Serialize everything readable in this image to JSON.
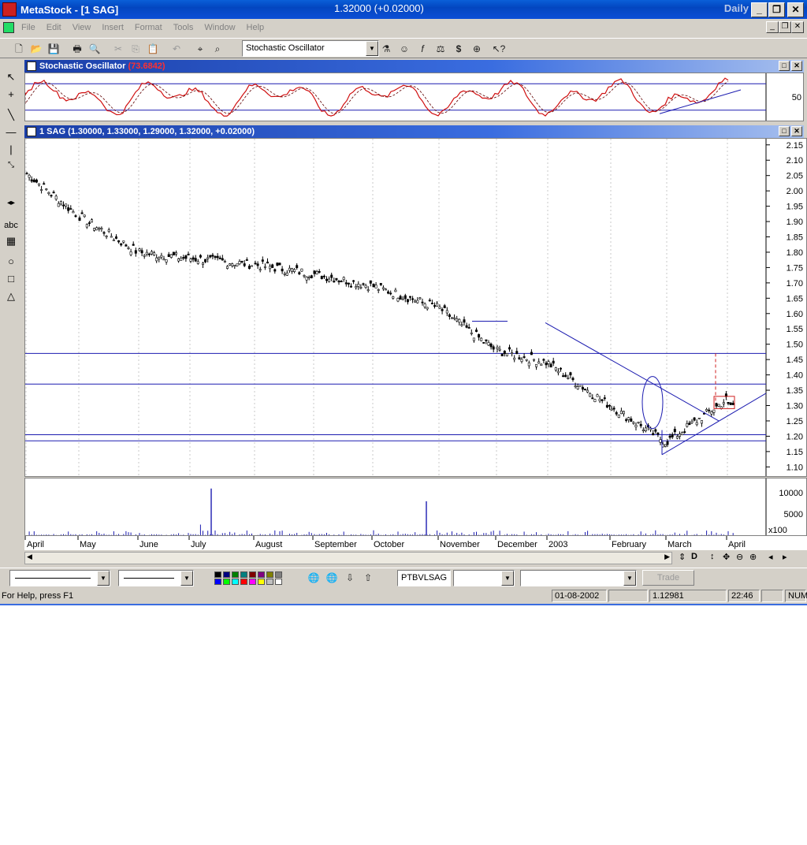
{
  "window": {
    "app_name": "MetaStock - [1 SAG]",
    "price_info": "1.32000 (+0.02000)",
    "period": "Daily",
    "controls": {
      "minimize": "_",
      "restore": "❐",
      "close": "✕"
    }
  },
  "menu": [
    "File",
    "Edit",
    "View",
    "Insert",
    "Format",
    "Tools",
    "Window",
    "Help"
  ],
  "toolbar": {
    "indicator_select": "Stochastic Oscillator"
  },
  "stochastic_panel": {
    "title": "Stochastic Oscillator",
    "value": "(73.6842)",
    "axis_label": "50"
  },
  "price_panel": {
    "title": "1 SAG (1.30000, 1.33000, 1.29000, 1.32000, +0.02000)",
    "y_ticks": [
      "2.15",
      "2.10",
      "2.05",
      "2.00",
      "1.95",
      "1.90",
      "1.85",
      "1.80",
      "1.75",
      "1.70",
      "1.65",
      "1.60",
      "1.55",
      "1.50",
      "1.45",
      "1.40",
      "1.35",
      "1.30",
      "1.25",
      "1.20",
      "1.15",
      "1.10"
    ]
  },
  "volume_panel": {
    "y_ticks": [
      "10000",
      "5000"
    ],
    "multiplier": "x100"
  },
  "x_axis": {
    "months": [
      "April",
      "May",
      "June",
      "July",
      "August",
      "September",
      "October",
      "November",
      "December",
      "2003",
      "February",
      "March",
      "April"
    ]
  },
  "scroll_controls": [
    "◀",
    "▶",
    "⇕",
    "D",
    "↕",
    "✥",
    "⊖",
    "⊕",
    "◂",
    "▸"
  ],
  "bottom_toolbar": {
    "security_field": "PTBVLSAG",
    "trade_button": "Trade"
  },
  "status_bar": {
    "help_text": "For Help, press F1",
    "date": "01-08-2002",
    "value": "1.12981",
    "time": "22:46",
    "num": "NUM"
  },
  "chart_data": {
    "type": "candlestick",
    "security": "1 SAG",
    "last_bar": {
      "open": 1.3,
      "high": 1.33,
      "low": 1.29,
      "close": 1.32,
      "change": 0.02
    },
    "ylim": [
      1.07,
      2.17
    ],
    "approx_closes_by_month": [
      {
        "month": "April",
        "close": 2.06
      },
      {
        "month": "May",
        "close": 1.92
      },
      {
        "month": "June",
        "close": 1.8
      },
      {
        "month": "July",
        "close": 1.78
      },
      {
        "month": "August",
        "close": 1.76
      },
      {
        "month": "September",
        "close": 1.73
      },
      {
        "month": "October",
        "close": 1.69
      },
      {
        "month": "November",
        "close": 1.62
      },
      {
        "month": "December",
        "close": 1.48
      },
      {
        "month": "2003",
        "close": 1.44
      },
      {
        "month": "February",
        "close": 1.3
      },
      {
        "month": "March",
        "close": 1.18
      },
      {
        "month": "April",
        "close": 1.32
      }
    ],
    "horizontal_lines": [
      1.47,
      1.37,
      1.205,
      1.185
    ],
    "volume_peaks": [
      {
        "month": "July",
        "value": 11000
      },
      {
        "month": "October",
        "value": 8000
      }
    ],
    "stochastic_last": 73.6842,
    "stochastic_levels": [
      20,
      80
    ]
  }
}
